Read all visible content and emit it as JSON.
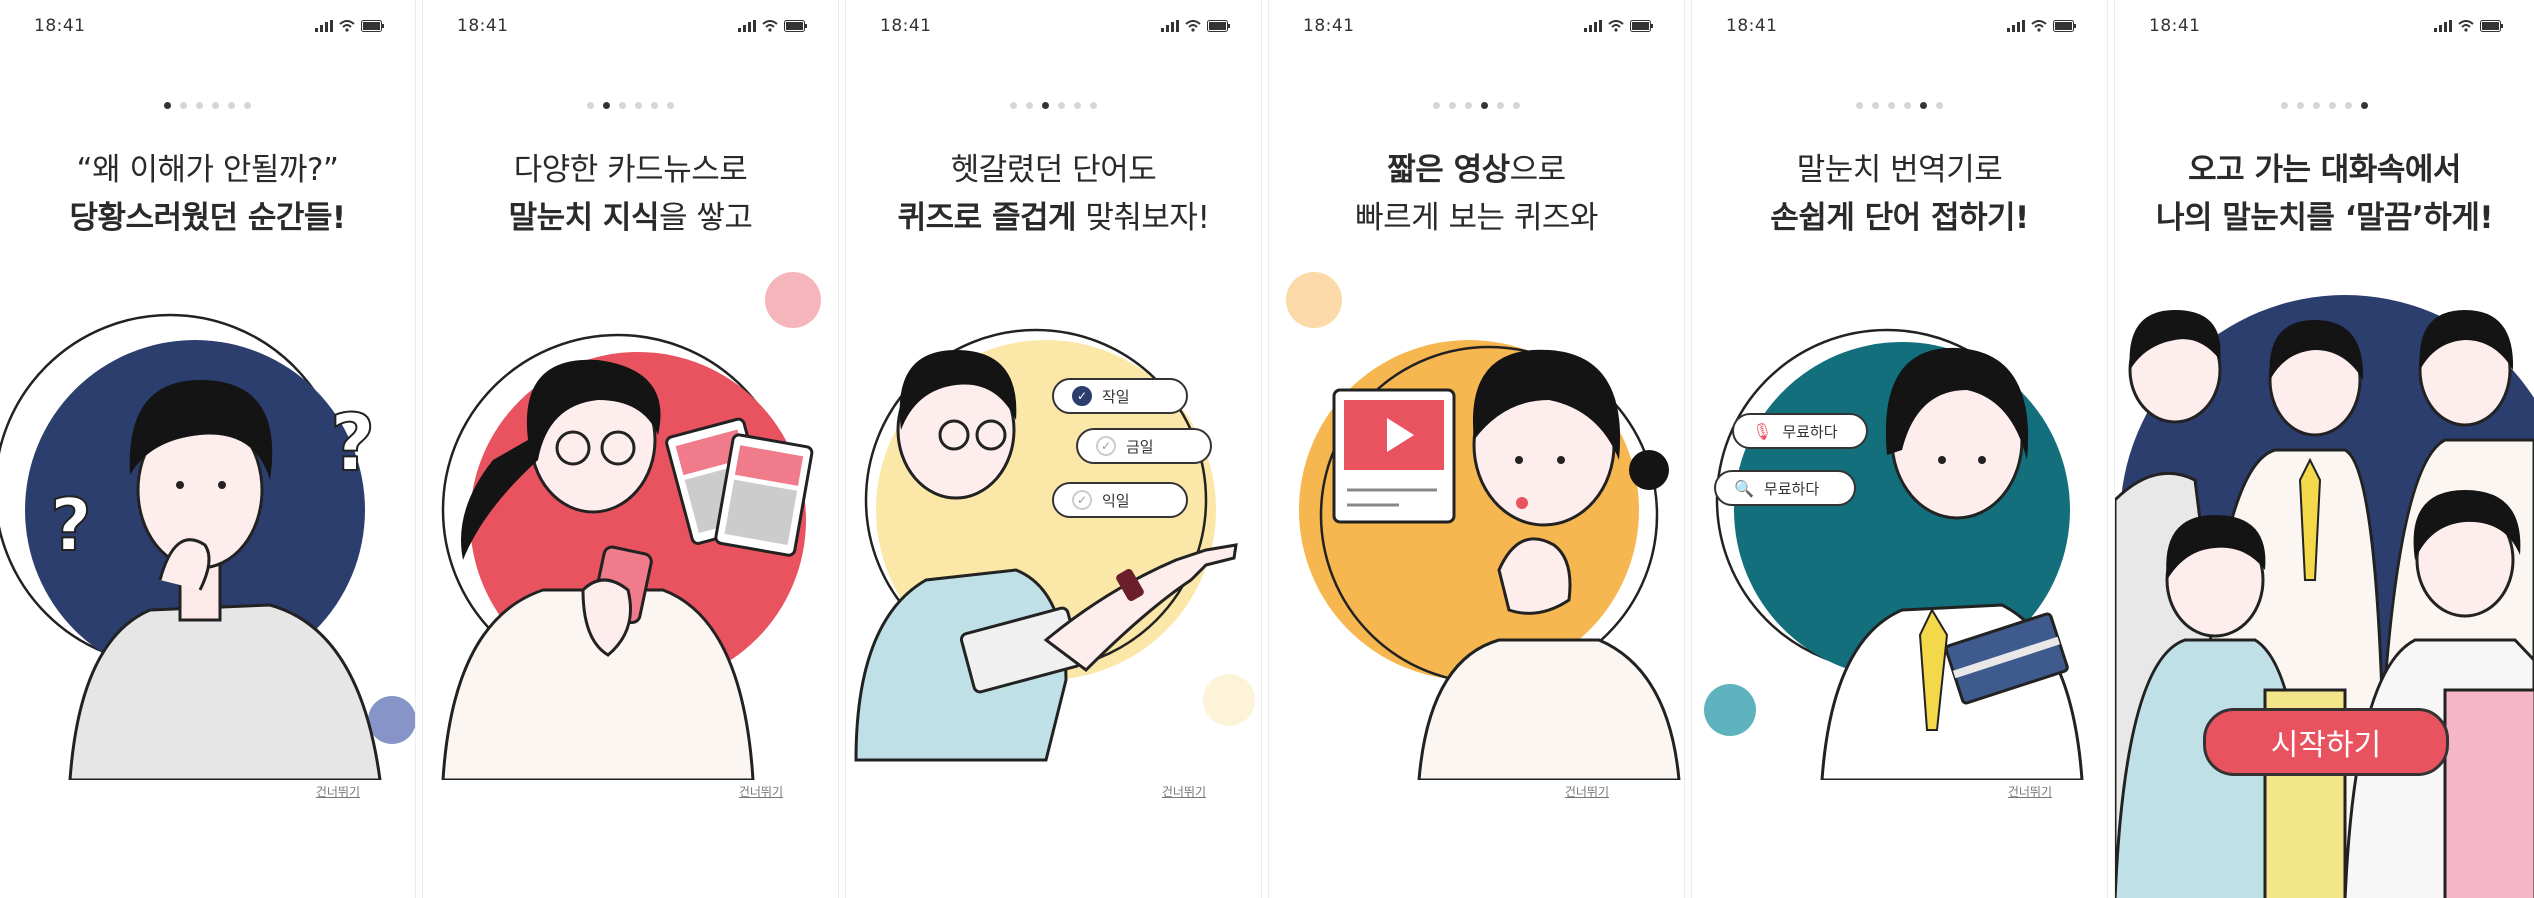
{
  "status_time": "18:41",
  "skip_label": "건너뛰기",
  "screens": [
    {
      "line1": "“왜 이해가 안될까?”",
      "line2": "당황스러웠던 순간들!"
    },
    {
      "line1": "다양한 카드뉴스로",
      "line2_hl": "말눈치 지식",
      "line2_rest": "을 쌓고"
    },
    {
      "line1": "헷갈렸던 단어도",
      "line2_hl": "퀴즈로 즐겁게",
      "line2_rest": " 맞춰보자!",
      "quiz_options": [
        "작일",
        "금일",
        "익일"
      ]
    },
    {
      "line1_hl": "짧은 영상",
      "line1_rest": "으로",
      "line2": "빠르게 보는 퀴즈와"
    },
    {
      "line1": "말눈치 번역기로",
      "line2": "손쉽게 단어 접하기!",
      "translate_chips": [
        "무료하다",
        "무료하다"
      ]
    },
    {
      "line1": "오고 가는 대화속에서",
      "line2_pre": "나의 ",
      "line2_hl": "말눈치를 ‘말끔’하게",
      "line2_post": "!",
      "start_label": "시작하기"
    }
  ],
  "colors": {
    "navy": "#2c3e6e",
    "coral": "#e9525f",
    "yellow": "#fbe7a8",
    "orange": "#f6b650",
    "teal": "#126f7b",
    "pink": "#f5b6bb"
  }
}
